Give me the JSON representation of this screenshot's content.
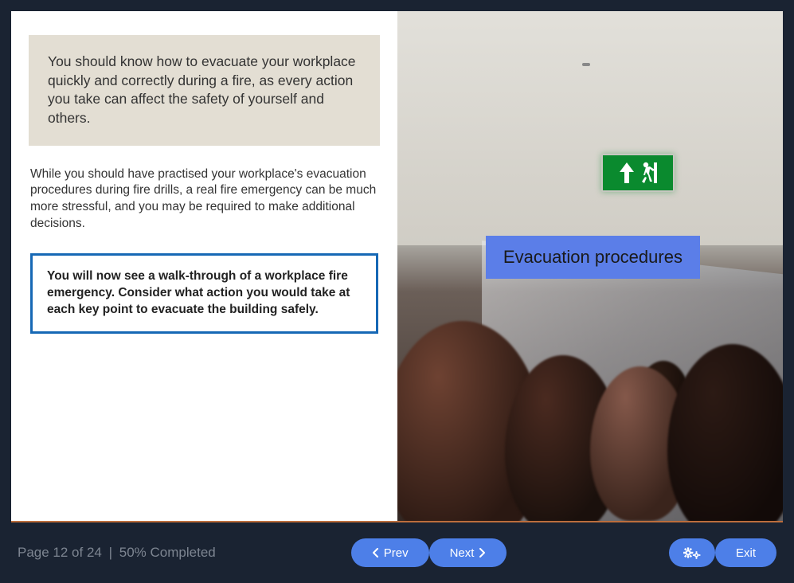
{
  "content": {
    "intro": "You should know how to evacuate your workplace quickly and correctly during a fire, as every action you take can affect the safety of yourself and others.",
    "paragraph": "While you should have practised your workplace's evacuation procedures during fire drills, a real fire emergency can be much more stressful, and you may be required to make additional decisions.",
    "callout": "You will now see a walk-through of a workplace fire emergency. Consider what action you would take at each key point to evacuate the building safely."
  },
  "overlay": {
    "title": "Evacuation procedures"
  },
  "footer": {
    "page_label": "Page 12 of 24",
    "completed_label": "50% Completed",
    "prev": "Prev",
    "next": "Next",
    "exit": "Exit"
  }
}
